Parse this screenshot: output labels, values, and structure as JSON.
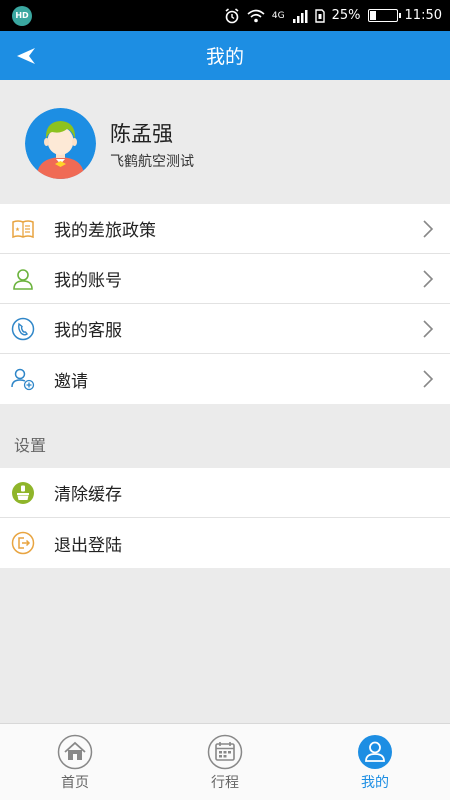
{
  "status_bar": {
    "hd_badge": "HD",
    "network": "4G",
    "battery_percent": "25%",
    "battery_level": 0.25,
    "time": "11:50"
  },
  "header": {
    "title": "我的"
  },
  "profile": {
    "name": "陈孟强",
    "organization": "飞鹤航空测试"
  },
  "menu": {
    "items": [
      {
        "label": "我的差旅政策",
        "icon": "policy-icon"
      },
      {
        "label": "我的账号",
        "icon": "account-icon"
      },
      {
        "label": "我的客服",
        "icon": "phone-icon"
      },
      {
        "label": "邀请",
        "icon": "invite-icon"
      }
    ]
  },
  "settings": {
    "section_title": "设置",
    "items": [
      {
        "label": "清除缓存",
        "icon": "clear-cache-icon"
      },
      {
        "label": "退出登陆",
        "icon": "logout-icon"
      }
    ]
  },
  "tabbar": {
    "tabs": [
      {
        "label": "首页",
        "icon": "home-icon"
      },
      {
        "label": "行程",
        "icon": "calendar-icon"
      },
      {
        "label": "我的",
        "icon": "user-icon"
      }
    ],
    "active": "我的"
  },
  "colors": {
    "primary": "#1d8ee3",
    "background": "#ebebeb",
    "green": "#8dc21f",
    "orange": "#f0a040"
  }
}
